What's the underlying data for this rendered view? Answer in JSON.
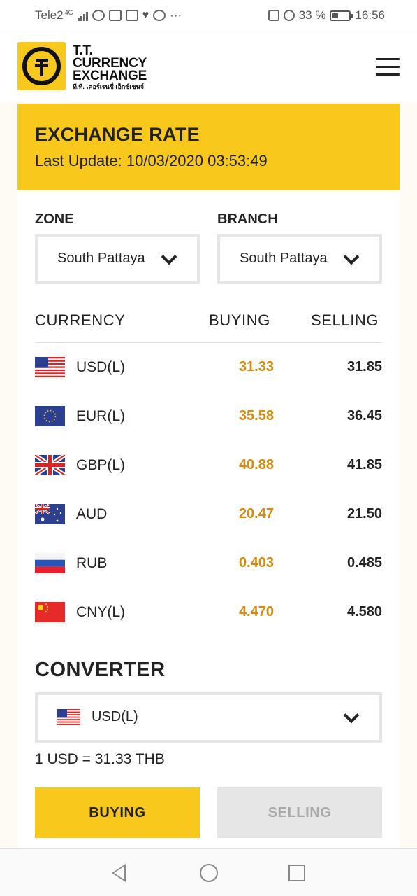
{
  "status_bar": {
    "carrier": "Tele2",
    "network": "4G",
    "battery": "33 %",
    "time": "16:56",
    "more": "···"
  },
  "header": {
    "brand_line1": "T.T.",
    "brand_line2": "CURRENCY",
    "brand_line3": "EXCHANGE",
    "brand_thai": "ที.ที. เคอร์เรนซี่ เอ็กซ์เชนจ์"
  },
  "exchange": {
    "title": "EXCHANGE RATE",
    "last_update": "Last Update: 10/03/2020 03:53:49"
  },
  "filters": {
    "zone_label": "ZONE",
    "zone_value": "South Pattaya",
    "branch_label": "BRANCH",
    "branch_value": "South Pattaya"
  },
  "table": {
    "headers": [
      "CURRENCY",
      "BUYING",
      "SELLING"
    ],
    "rows": [
      {
        "code": "USD(L)",
        "buying": "31.33",
        "selling": "31.85",
        "flag": "us-flag"
      },
      {
        "code": "EUR(L)",
        "buying": "35.58",
        "selling": "36.45",
        "flag": "eu-flag"
      },
      {
        "code": "GBP(L)",
        "buying": "40.88",
        "selling": "41.85",
        "flag": "uk-flag"
      },
      {
        "code": "AUD",
        "buying": "20.47",
        "selling": "21.50",
        "flag": "au-flag"
      },
      {
        "code": "RUB",
        "buying": "0.403",
        "selling": "0.485",
        "flag": "ru-flag"
      },
      {
        "code": "CNY(L)",
        "buying": "4.470",
        "selling": "4.580",
        "flag": "cn-flag"
      }
    ]
  },
  "converter": {
    "title": "CONVERTER",
    "selected_currency": "USD(L)",
    "rate_note": "1 USD = 31.33 THB",
    "buying_label": "BUYING",
    "selling_label": "SELLING"
  },
  "colors": {
    "accent": "#f8c81c",
    "buying_value": "#d78a10"
  }
}
